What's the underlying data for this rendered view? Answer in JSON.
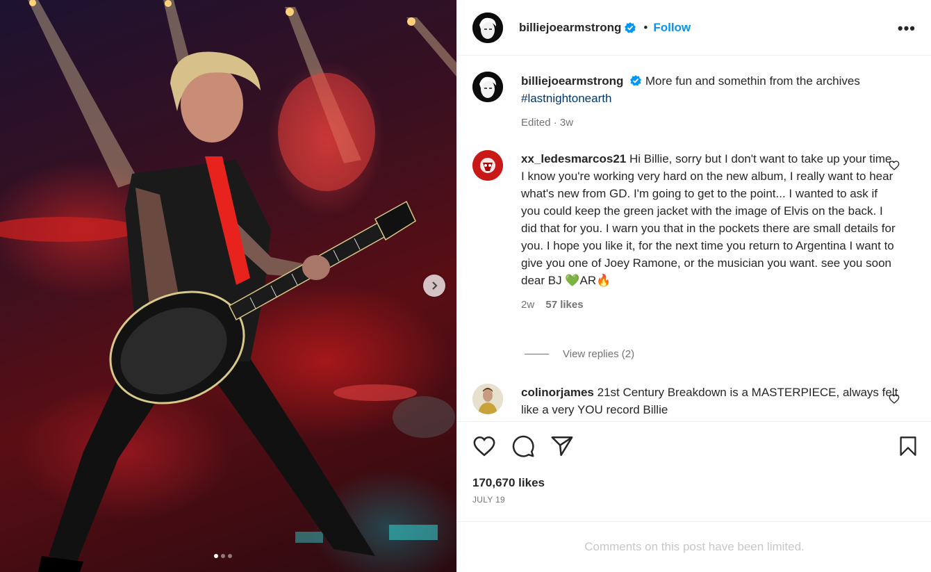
{
  "post": {
    "author": "billiejoearmstrong",
    "separator": "•",
    "follow_label": "Follow",
    "more_label": "•••"
  },
  "caption": {
    "author": "billiejoearmstrong",
    "text": "More fun and somethin from the archives",
    "hashtag": "#lastnightonearth",
    "meta": "Edited · 3w"
  },
  "comments": [
    {
      "author": "xx_ledesmarcos21",
      "text": "Hi Billie, sorry but I don't want to take up your time. I know you're working very hard on the new album, I really want to hear what's new from GD. I'm going to get to the point... I wanted to ask if you could keep the green jacket with the image of Elvis on the back. I did that for you. I warn you that in the pockets there are small details for you. I hope you like it, for the next time you return to Argentina I want to give you one of Joey Ramone, or the musician you want. see you soon dear BJ 💚AR🔥",
      "age": "2w",
      "likes": "57 likes",
      "view_replies": "View replies (2)"
    },
    {
      "author": "colinorjames",
      "text": "21st Century Breakdown is a MASTERPIECE, always felt like a very YOU record Billie"
    }
  ],
  "stats": {
    "likes": "170,670 likes",
    "date": "JULY 19"
  },
  "limited_notice": "Comments on this post have been limited.",
  "carousel": {
    "slides": 3,
    "active": 0
  },
  "colors": {
    "accent": "#0095f6",
    "verified": "#0095f6",
    "muted": "#737373"
  },
  "icons": [
    "verified-badge-icon",
    "more-options-icon",
    "heart-icon",
    "comment-icon",
    "share-icon",
    "bookmark-icon",
    "chevron-right-icon"
  ]
}
